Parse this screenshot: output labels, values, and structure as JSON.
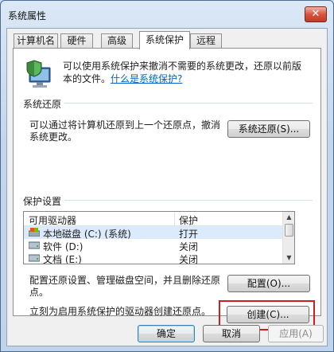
{
  "window": {
    "title": "系统属性",
    "close_glyph": "✕"
  },
  "tabs": [
    {
      "label": "计算机名"
    },
    {
      "label": "硬件"
    },
    {
      "label": "高级"
    },
    {
      "label": "系统保护"
    },
    {
      "label": "远程"
    }
  ],
  "intro": {
    "text": "可以使用系统保护来撤消不需要的系统更改，还原以前版本的文件。",
    "link": "什么是系统保护?"
  },
  "restore": {
    "heading": "系统还原",
    "description": "可以通过将计算机还原到上一个还原点，撤消系统更改。",
    "button": "系统还原(S)..."
  },
  "protection": {
    "heading": "保护设置",
    "columns": [
      "可用驱动器",
      "保护"
    ],
    "drives": [
      {
        "name": "本地磁盘 (C:) (系统)",
        "status": "打开",
        "icon": "system-drive-icon"
      },
      {
        "name": "软件 (D:)",
        "status": "关闭",
        "icon": "hard-drive-icon"
      },
      {
        "name": "文档 (E:)",
        "status": "关闭",
        "icon": "hard-drive-icon"
      }
    ],
    "configure_text": "配置还原设置、管理磁盘空间，并且删除还原点。",
    "configure_button": "配置(O)...",
    "create_text": "立刻为启用系统保护的驱动器创建还原点。",
    "create_button": "创建(C)..."
  },
  "footer": {
    "ok": "确定",
    "cancel": "取消",
    "apply": "应用(A)"
  },
  "colors": {
    "highlight": "#d01d1d",
    "link": "#0066cc"
  }
}
